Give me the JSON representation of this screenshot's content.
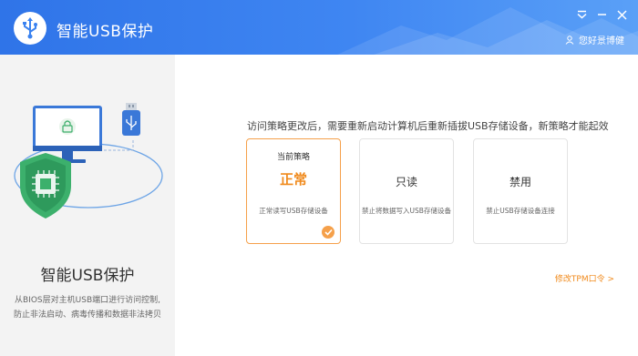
{
  "header": {
    "title": "智能USB保护",
    "user_name": "您好景博健",
    "icons": [
      "usb-icon",
      "dropdown-icon",
      "minimize-icon",
      "close-icon",
      "user-icon"
    ],
    "colors": {
      "brand": "#3a82f0"
    }
  },
  "sidebar": {
    "title": "智能USB保护",
    "desc_line1": "从BIOS层对主机USB端口进行访问控制,",
    "desc_line2": "防止非法启动、病毒传播和数据非法拷贝"
  },
  "main": {
    "notice": "访问策略更改后，需要重新启动计算机后重新插拔USB存储设备，新策略才能起效",
    "cards": [
      {
        "tag": "当前策略",
        "name": "正常",
        "desc": "正常读写USB存储设备",
        "selected": true
      },
      {
        "tag": "",
        "name": "只读",
        "desc": "禁止将数据写入USB存储设备",
        "selected": false
      },
      {
        "tag": "",
        "name": "禁用",
        "desc": "禁止USB存储设备连接",
        "selected": false
      }
    ],
    "tpm_link": "修改TPM口令 >",
    "colors": {
      "accent": "#f5a04a"
    }
  }
}
